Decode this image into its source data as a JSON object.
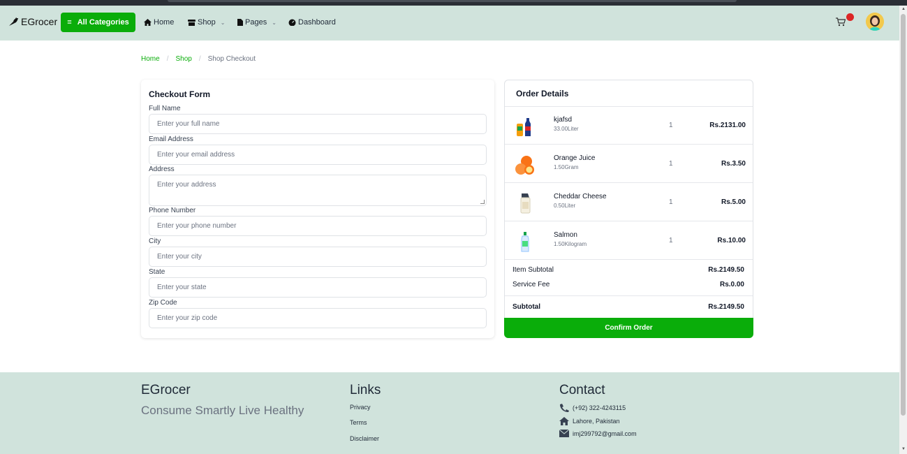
{
  "navbar": {
    "brand": "EGrocer",
    "categories_button": "All Categories",
    "items": [
      {
        "label": "Home"
      },
      {
        "label": "Shop"
      },
      {
        "label": "Pages"
      },
      {
        "label": "Dashboard"
      }
    ]
  },
  "breadcrumb": {
    "home": "Home",
    "shop": "Shop",
    "current": "Shop Checkout"
  },
  "checkout_form": {
    "title": "Checkout Form",
    "fields": [
      {
        "label": "Full Name",
        "placeholder": "Enter your full name"
      },
      {
        "label": "Email Address",
        "placeholder": "Enter your email address"
      },
      {
        "label": "Address",
        "placeholder": "Enter your address"
      },
      {
        "label": "Phone Number",
        "placeholder": "Enter your phone number"
      },
      {
        "label": "City",
        "placeholder": "Enter your city"
      },
      {
        "label": "State",
        "placeholder": "Enter your state"
      },
      {
        "label": "Zip Code",
        "placeholder": "Enter your zip code"
      }
    ]
  },
  "order": {
    "title": "Order Details",
    "items": [
      {
        "name": "kjafsd",
        "unit": "33.00Liter",
        "qty": "1",
        "price": "Rs.2131.00",
        "icon": "drink-bottles-icon"
      },
      {
        "name": "Orange Juice",
        "unit": "1.50Gram",
        "qty": "1",
        "price": "Rs.3.50",
        "icon": "orange-icon"
      },
      {
        "name": "Cheddar Cheese",
        "unit": "0.50Liter",
        "qty": "1",
        "price": "Rs.5.00",
        "icon": "jar-icon"
      },
      {
        "name": "Salmon",
        "unit": "1.50Kilogram",
        "qty": "1",
        "price": "Rs.10.00",
        "icon": "bottle-icon"
      }
    ],
    "item_subtotal_label": "Item Subtotal",
    "item_subtotal": "Rs.2149.50",
    "service_fee_label": "Service Fee",
    "service_fee": "Rs.0.00",
    "subtotal_label": "Subtotal",
    "subtotal": "Rs.2149.50",
    "confirm_button": "Confirm Order"
  },
  "footer": {
    "brand": "EGrocer",
    "tagline": "Consume Smartly Live Healthy",
    "links_title": "Links",
    "links": [
      "Privacy",
      "Terms",
      "Disclaimer"
    ],
    "contact_title": "Contact",
    "phone": "(+92) 322-4243115",
    "address": "Lahore, Pakistan",
    "email": "imj299792@gmail.com"
  },
  "colors": {
    "accent": "#0aad0a",
    "nav_bg": "#d0e3dc",
    "badge": "#dc2626"
  }
}
